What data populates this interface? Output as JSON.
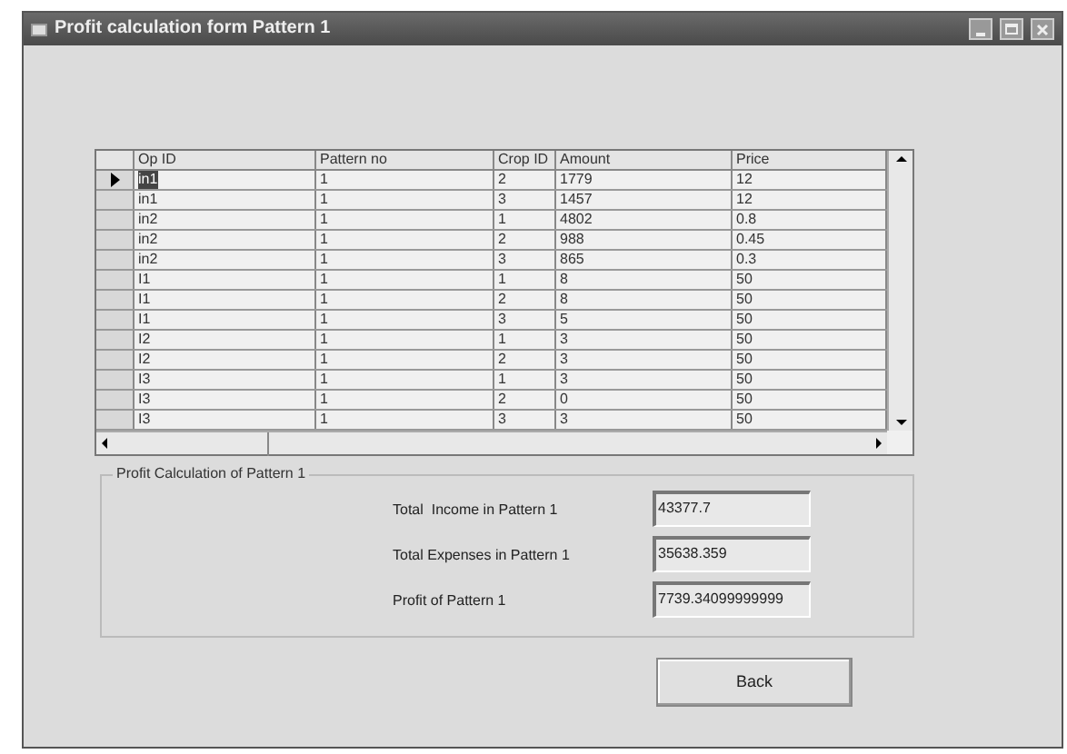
{
  "window": {
    "title": "Profit calculation form Pattern 1"
  },
  "table": {
    "columns": [
      "Op ID",
      "Pattern no",
      "Crop ID",
      "Amount",
      "Price"
    ],
    "rows": [
      {
        "cells": [
          "in1",
          "1",
          "2",
          "1779",
          "12"
        ],
        "selected": true
      },
      {
        "cells": [
          "in1",
          "1",
          "3",
          "1457",
          "12"
        ],
        "selected": false
      },
      {
        "cells": [
          "in2",
          "1",
          "1",
          "4802",
          "0.8"
        ],
        "selected": false
      },
      {
        "cells": [
          "in2",
          "1",
          "2",
          "988",
          "0.45"
        ],
        "selected": false
      },
      {
        "cells": [
          "in2",
          "1",
          "3",
          "865",
          "0.3"
        ],
        "selected": false
      },
      {
        "cells": [
          "I1",
          "1",
          "1",
          "8",
          "50"
        ],
        "selected": false
      },
      {
        "cells": [
          "I1",
          "1",
          "2",
          "8",
          "50"
        ],
        "selected": false
      },
      {
        "cells": [
          "I1",
          "1",
          "3",
          "5",
          "50"
        ],
        "selected": false
      },
      {
        "cells": [
          "I2",
          "1",
          "1",
          "3",
          "50"
        ],
        "selected": false
      },
      {
        "cells": [
          "I2",
          "1",
          "2",
          "3",
          "50"
        ],
        "selected": false
      },
      {
        "cells": [
          "I3",
          "1",
          "1",
          "3",
          "50"
        ],
        "selected": false
      },
      {
        "cells": [
          "I3",
          "1",
          "2",
          "0",
          "50"
        ],
        "selected": false
      },
      {
        "cells": [
          "I3",
          "1",
          "3",
          "3",
          "50"
        ],
        "selected": false
      }
    ]
  },
  "group": {
    "title": "Profit Calculation of Pattern 1",
    "fields": [
      {
        "label": "Total  Income in Pattern 1",
        "value": "43377.7"
      },
      {
        "label": "Total Expenses in Pattern 1",
        "value": "35638.359"
      },
      {
        "label": "Profit of Pattern 1",
        "value": "7739.34099999999"
      }
    ]
  },
  "buttons": [
    "Back"
  ]
}
